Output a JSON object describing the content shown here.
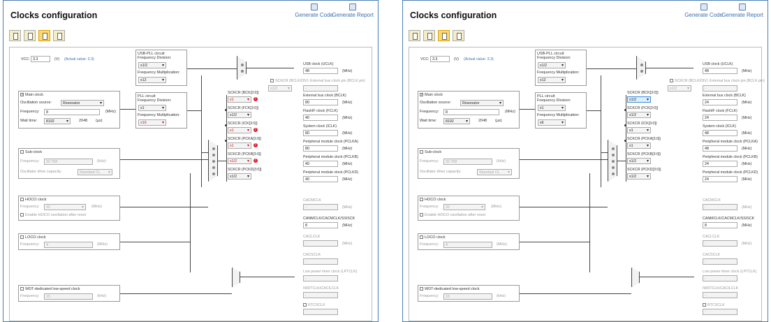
{
  "left": {
    "title": "Clocks configuration",
    "generate_code": "Generate Code",
    "generate_report": "Generate Report",
    "vcc_label": "VCC:",
    "vcc_value": "3.3",
    "vcc_unit": "(V)",
    "vcc_actual": "(Actual value: 3.3)",
    "usbpll_title": "USB-PLL circuit",
    "usbpll_div_label": "Frequency Division:",
    "usbpll_div": "x1/2",
    "usbpll_mul_label": "Frequency Multiplication:",
    "usbpll_mul": "x12",
    "main_clock": "Main clock",
    "osc_source_label": "Oscillation source:",
    "osc_source": "Resonator",
    "freq_label": "Frequency:",
    "freq_value": "8",
    "mhz": "(MHz)",
    "wait_label": "Wait time:",
    "wait_value": "8192",
    "wait_n": "2048",
    "wait_unit": "(µs)",
    "pll_title": "PLL circuit",
    "pll_div_label": "Frequency Division:",
    "pll_div": "x1",
    "pll_mul_label": "Frequency Multiplication:",
    "pll_mul": "x10",
    "sub_clock": "Sub-clock",
    "sub_freq": "32.768",
    "khz": "(kHz)",
    "sub_drive_label": "Oscillator drive capacity:",
    "sub_drive": "Standard CL",
    "hoco": "HOCO clock",
    "hoco_freq": "32",
    "hoco_enable": "Enable HOCO oscillation after reset",
    "loco": "LOCO clock",
    "loco_freq": "4",
    "wdt": "WDT-dedicated low-speed clock",
    "wdt_freq": "15",
    "usb_clock": "USB clock (UCLK)",
    "usb_val": "48",
    "sckcr_bclk_pin": "SCKCR (BCLK/DIV)",
    "ext_bus_pin": "External bus clock pin (BCLK pin)",
    "ext_pin_val": "x1/2",
    "sckcr_bck": "SCKCR (BCK[3:0])",
    "sckcr_bck_val": "x1",
    "ext_bus": "External bus clock (BCLK)",
    "ext_bus_val": "80",
    "sckcr_fck": "SCKCR (FCK[3:0])",
    "sckcr_fck_val": "x1/2",
    "fclk": "FlashIF clock (FCLK)",
    "fclk_val": "40",
    "sckcr_ick": "SCKCR (ICK[3:0])",
    "sckcr_ick_val": "x1",
    "iclk": "System clock (ICLK)",
    "iclk_val": "80",
    "sckcr_pcka": "SCKCR (PCKA[3:0])",
    "sckcr_pcka_val": "x1",
    "pclka": "Peripheral module clock (PCLKA)",
    "pclka_val": "80",
    "sckcr_pckb": "SCKCR (PCKB[3:0])",
    "sckcr_pckb_val": "x1/2",
    "pclkb": "Peripheral module clock (PCLKB)",
    "pclkb_val": "40",
    "sckcr_pckd": "SCKCR (PCKD[3:0])",
    "sckcr_pckd_val": "x1/2",
    "pclkd": "Peripheral module clock (PCLKD)",
    "pclkd_val": "40",
    "cacmclk": "CACMCLK",
    "cacmclk_val": "-",
    "can_label": "CANMCLK/CACMCLK/SSISCK",
    "can_val": "8",
    "caclclk": "CACLCLK",
    "cacsclk": "CACSCLK",
    "lpt": "Low power timer clock (LPTCLK)",
    "iwdt": "IWDTCLK/CACILCLK",
    "rtc": "RTCSCLK",
    "dash": "-"
  },
  "right": {
    "title": "Clocks configuration",
    "generate_code": "Generate Code",
    "generate_report": "Generate Report",
    "vcc_label": "VCC:",
    "vcc_value": "3.3",
    "vcc_unit": "(V)",
    "vcc_actual": "(Actual value: 3.3)",
    "usbpll_title": "USB-PLL circuit",
    "usbpll_div_label": "Frequency Division:",
    "usbpll_div": "x1/2",
    "usbpll_mul_label": "Frequency Multiplication:",
    "usbpll_mul": "x12",
    "main_clock": "Main clock",
    "osc_source_label": "Oscillation source:",
    "osc_source": "Resonator",
    "freq_label": "Frequency:",
    "freq_value": "8",
    "mhz": "(MHz)",
    "wait_label": "Wait time:",
    "wait_value": "8192",
    "wait_n": "2048",
    "wait_unit": "(µs)",
    "pll_title": "PLL circuit",
    "pll_div_label": "Frequency Division:",
    "pll_div": "x1",
    "pll_mul_label": "Frequency Multiplication:",
    "pll_mul": "x6",
    "sub_clock": "Sub-clock",
    "sub_freq": "32.768",
    "khz": "(kHz)",
    "sub_drive_label": "Oscillator drive capacity:",
    "sub_drive": "Standard CL",
    "hoco": "HOCO clock",
    "hoco_freq": "32",
    "hoco_enable": "Enable HOCO oscillation after reset",
    "loco": "LOCO clock",
    "loco_freq": "4",
    "wdt": "WDT-dedicated low-speed clock",
    "wdt_freq": "15",
    "usb_clock": "USB clock (UCLK)",
    "usb_val": "48",
    "sckcr_bclk_pin": "SCKCR (BCLK/DIV)",
    "ext_bus_pin": "External bus clock pin (BCLK pin)",
    "ext_pin_val": "x1/2",
    "sckcr_bck": "SCKCR (BCK[3:0])",
    "sckcr_bck_val": "x1/2",
    "ext_bus": "External bus clock (BCLK)",
    "ext_bus_val": "24",
    "sckcr_fck": "SCKCR (FCK[3:0])",
    "sckcr_fck_val": "x1/2",
    "fclk": "FlashIF clock (FCLK)",
    "fclk_val": "24",
    "sckcr_ick": "SCKCR (ICK[3:0])",
    "sckcr_ick_val": "x1",
    "iclk": "System clock (ICLK)",
    "iclk_val": "48",
    "sckcr_pcka": "SCKCR (PCKA[3:0])",
    "sckcr_pcka_val": "x1",
    "pclka": "Peripheral module clock (PCLKA)",
    "pclka_val": "48",
    "sckcr_pckb": "SCKCR (PCKB[3:0])",
    "sckcr_pckb_val": "x1/2",
    "pclkb": "Peripheral module clock (PCLKB)",
    "pclkb_val": "24",
    "sckcr_pckd": "SCKCR (PCKD[3:0])",
    "sckcr_pckd_val": "x1/2",
    "pclkd": "Peripheral module clock (PCLKD)",
    "pclkd_val": "24",
    "cacmclk": "CACMCLK",
    "cacmclk_val": "-",
    "can_label": "CANMCLK/CACMCLK/SSISCK",
    "can_val": "8",
    "caclclk": "CACLCLK",
    "cacsclk": "CACSCLK",
    "lpt": "Low power timer clock (LPTCLK)",
    "iwdt": "IWDTCLK/CACILCLK",
    "rtc": "RTCSCLK",
    "dash": "-"
  }
}
